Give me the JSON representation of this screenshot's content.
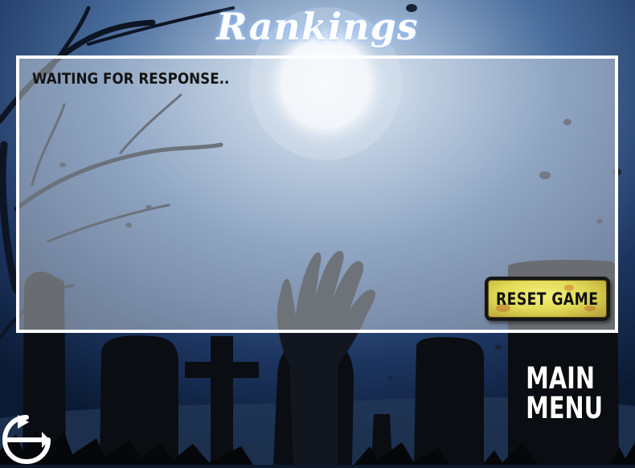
{
  "screen": {
    "title": "Rankings",
    "status_text": "WAITING FOR RESPONSE..",
    "reset_button_label": "RESET GAME",
    "main_menu_label": "MAIN\nMENU"
  },
  "colors": {
    "sky_top": "#0b1a33",
    "moon_glow": "#dfe8f3",
    "panel_border": "#ffffff",
    "button_yellow": "#e2dc58",
    "silhouette": "#0a0d12"
  },
  "icons": {
    "back": "back-arrow-icon",
    "background": "graveyard-scene"
  }
}
